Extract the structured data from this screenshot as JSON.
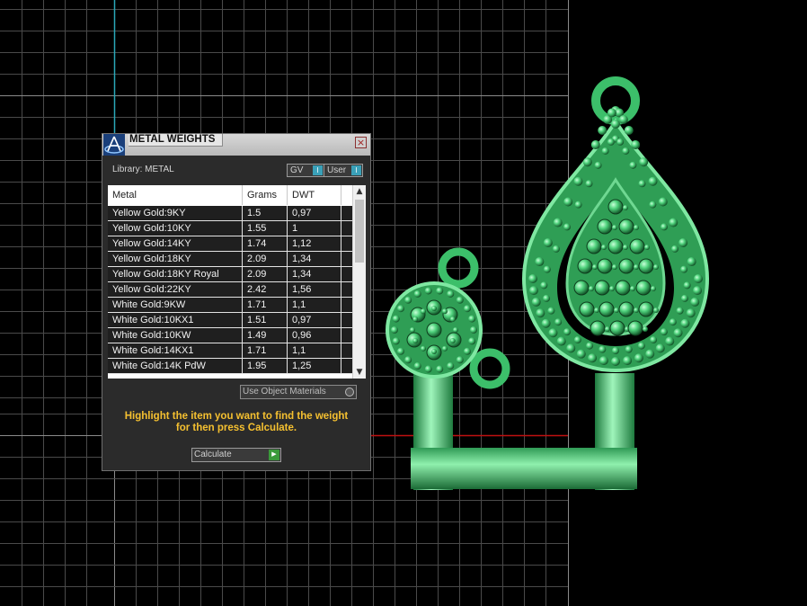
{
  "dialog": {
    "title": "METAL WEIGHTS",
    "close_icon": "close-icon",
    "app_icon": "matrix-app-icon",
    "library_label": "Library: METAL",
    "toggle_gv": "GV",
    "toggle_user": "User",
    "toggle_indicator": "I",
    "table": {
      "headers": [
        "Metal",
        "Grams",
        "DWT"
      ],
      "rows": [
        {
          "metal": "Yellow Gold:9KY",
          "grams": "1.5",
          "dwt": "0,97"
        },
        {
          "metal": "Yellow Gold:10KY",
          "grams": "1.55",
          "dwt": "1"
        },
        {
          "metal": "Yellow Gold:14KY",
          "grams": "1.74",
          "dwt": "1,12"
        },
        {
          "metal": "Yellow Gold:18KY",
          "grams": "2.09",
          "dwt": "1,34"
        },
        {
          "metal": "Yellow Gold:18KY Royal",
          "grams": "2.09",
          "dwt": "1,34"
        },
        {
          "metal": "Yellow Gold:22KY",
          "grams": "2.42",
          "dwt": "1,56"
        },
        {
          "metal": "White Gold:9KW",
          "grams": "1.71",
          "dwt": "1,1"
        },
        {
          "metal": "White Gold:10KX1",
          "grams": "1.51",
          "dwt": "0,97"
        },
        {
          "metal": "White Gold:10KW",
          "grams": "1.49",
          "dwt": "0,96"
        },
        {
          "metal": "White Gold:14KX1",
          "grams": "1.71",
          "dwt": "1,1"
        },
        {
          "metal": "White Gold:14K PdW",
          "grams": "1.95",
          "dwt": "1,25"
        }
      ]
    },
    "use_object_materials": "Use Object Materials",
    "instructions_line1": "Highlight the item you want to find the weight",
    "instructions_line2": "for then press Calculate.",
    "calculate_label": "Calculate"
  },
  "colors": {
    "instructions": "#f5c030",
    "model_green": "#3cbf6a",
    "grid_line": "#5a5a5a",
    "axis_red": "#c01010",
    "axis_cyan": "#2aa8b8"
  }
}
